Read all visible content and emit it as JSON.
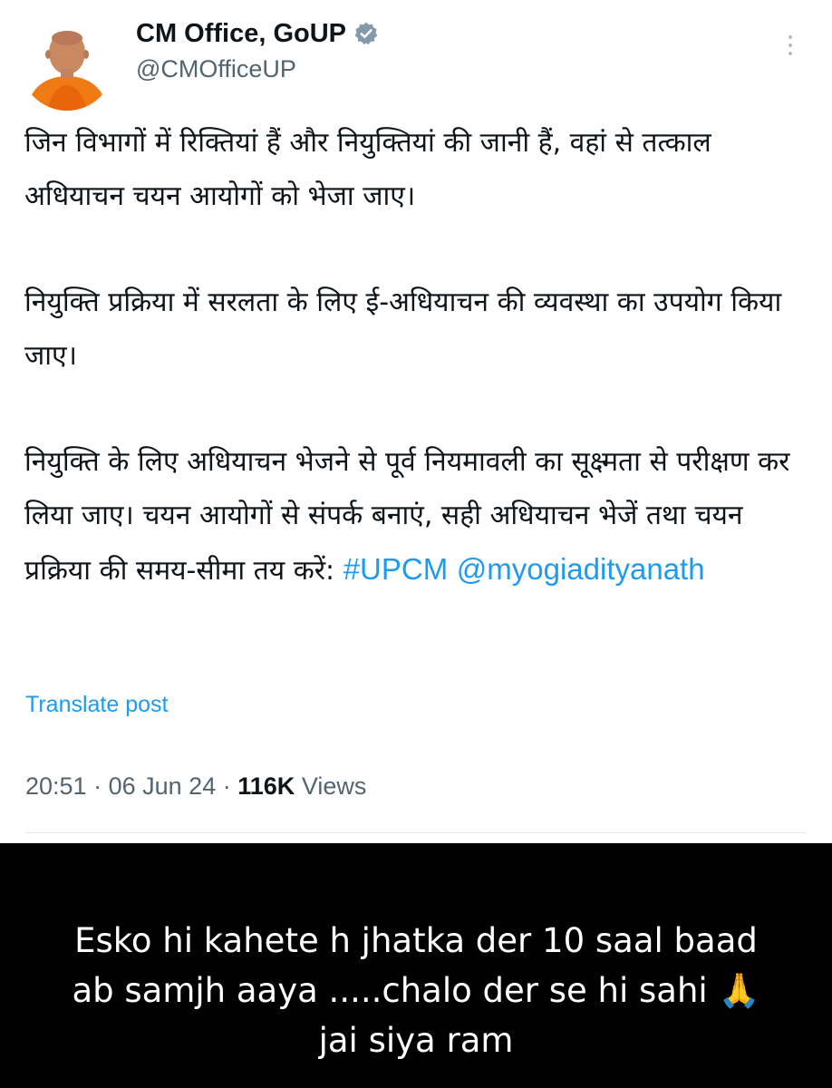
{
  "post": {
    "author": {
      "name": "CM Office, GoUP",
      "handle": "@CMOfficeUP",
      "verified": true
    },
    "paragraphs": [
      "जिन विभागों में रिक्तियां हैं और नियुक्तियां की जानी हैं, वहां से तत्काल अधियाचन चयन आयोगों को भेजा जाए।",
      "नियुक्ति प्रक्रिया में सरलता के लिए ई-अधियाचन की व्यवस्था का उपयोग किया जाए।",
      "नियुक्ति के लिए अधियाचन भेजने से पूर्व नियमावली का सूक्ष्मता से परीक्षण कर लिया जाए। चयन आयोगों से संपर्क बनाएं, सही अधियाचन भेजें तथा चयन प्रक्रिया की समय-सीमा तय करें:"
    ],
    "hashtag": "#UPCM",
    "mention": "@myogiadityanath",
    "translate_label": "Translate post",
    "time": "20:51",
    "date": "06 Jun 24",
    "views_count": "116K",
    "views_label": "Views",
    "separator": "·"
  },
  "caption": {
    "lines": [
      "Esko hi kahete h jhatka der 10 saal baad",
      "ab samjh aaya .....chalo der se hi sahi 🙏",
      "jai siya ram"
    ]
  },
  "colors": {
    "link": "#1d9bf0",
    "text": "#0f1419",
    "secondary": "#536471",
    "caption_bg": "#000000",
    "caption_text": "#ffffff"
  },
  "icons": {
    "verified": "verified-badge-icon",
    "more": "more-vertical-icon",
    "avatar": "profile-avatar"
  }
}
